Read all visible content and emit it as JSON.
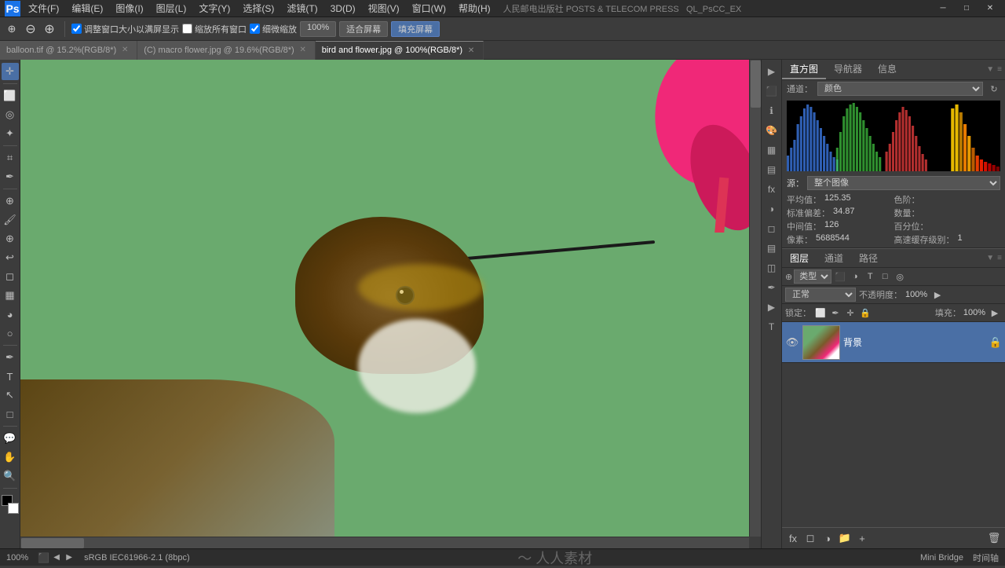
{
  "app": {
    "title": "Adobe Photoshop",
    "logo": "Ps"
  },
  "menubar": {
    "items": [
      "文件(F)",
      "编辑(E)",
      "图像(I)",
      "图层(L)",
      "文字(Y)",
      "选择(S)",
      "滤镜(T)",
      "3D(D)",
      "视图(V)",
      "窗口(W)",
      "帮助(H)"
    ]
  },
  "window_controls": {
    "minimize": "─",
    "maximize": "□",
    "close": "✕"
  },
  "toolbar": {
    "zoom_pct": "100%",
    "checkbox1_label": "调整窗口大小以满屏显示",
    "checkbox2_label": "缩放所有窗口",
    "checkbox3_label": "细微缩放",
    "btn_fit_screen": "适合屏幕",
    "btn_fill_screen": "填充屏幕"
  },
  "tabs": [
    {
      "label": "balloon.tif @ 15.2%(RGB/8*)",
      "active": false
    },
    {
      "label": "(C) macro flower.jpg @ 19.6%(RGB/8*)",
      "active": false
    },
    {
      "label": "bird and flower.jpg @ 100%(RGB/8*)",
      "active": true
    }
  ],
  "histogram": {
    "panel_tabs": [
      "直方图",
      "导航器",
      "信息"
    ],
    "active_panel_tab": "直方图",
    "channel_label": "通道：",
    "channel_value": "颜色",
    "source_label": "源：",
    "source_value": "整个图像",
    "stats": {
      "mean_label": "平均值：",
      "mean_value": "125.35",
      "stddev_label": "标准偏差：",
      "stddev_value": "34.87",
      "median_label": "中间值：",
      "median_value": "126",
      "pixels_label": "像素：",
      "pixels_value": "5688544",
      "color_label": "色阶：",
      "color_value": "",
      "count_label": "数量：",
      "count_value": "",
      "percentile_label": "百分位：",
      "percentile_value": "",
      "cache_label": "高速缓存级别：",
      "cache_value": "1"
    }
  },
  "layers": {
    "tabs": [
      "图层",
      "通道",
      "路径"
    ],
    "active_tab": "图层",
    "filter_label": "类型",
    "blend_mode": "正常",
    "opacity_label": "不透明度：",
    "opacity_value": "100%",
    "lock_label": "锁定：",
    "fill_label": "填充：",
    "fill_value": "100%",
    "items": [
      {
        "name": "背景",
        "visible": true,
        "locked": true,
        "active": true
      }
    ]
  },
  "statusbar": {
    "zoom": "100%",
    "color_profile": "sRGB IEC61966-2.1 (8bpc)",
    "mini_bridge": "Mini Bridge",
    "time_axis": "时间轴",
    "watermark": "人人素材"
  },
  "right_icons": [
    "▶",
    "⬛",
    "⬛",
    "⬛",
    "⬛",
    "⬛",
    "⬛",
    "⬛",
    "⬛",
    "⬛"
  ],
  "toolbox_tools": [
    "move",
    "rect-select",
    "lasso",
    "magic-wand",
    "crop",
    "eyedropper",
    "healing",
    "brush",
    "clone",
    "history-brush",
    "eraser",
    "gradient",
    "blur",
    "dodge",
    "pen",
    "type",
    "path-select",
    "shape",
    "note",
    "hand",
    "zoom"
  ]
}
